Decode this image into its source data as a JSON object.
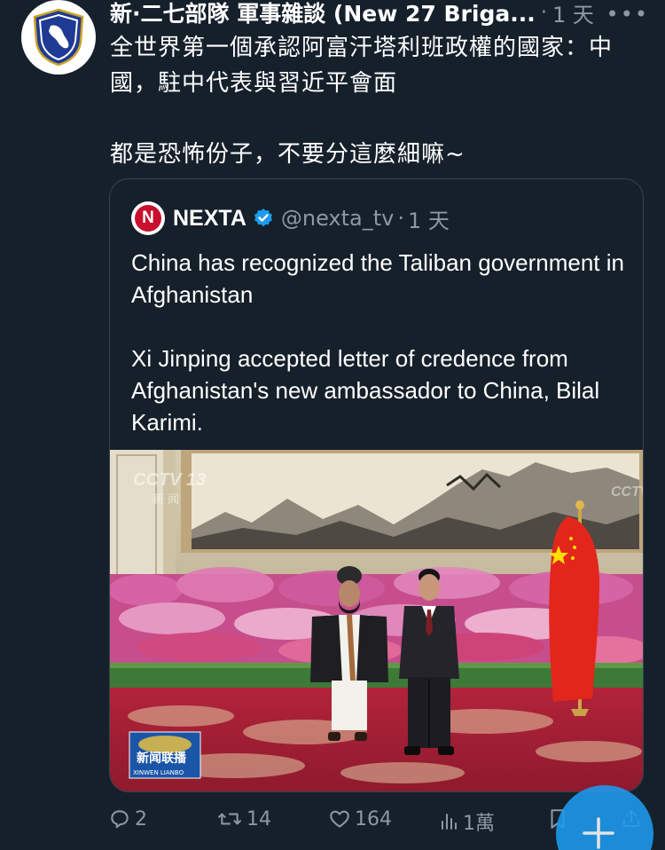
{
  "tweet": {
    "author_name": "新·二七部隊 軍事雜談 (New 27 Briga...",
    "separator": "·",
    "time": "1 天",
    "more_label": "•••",
    "text": "全世界第一個承認阿富汗塔利班政權的國家：中國，駐中代表與習近平會面\n\n都是恐怖份子，不要分這麼細嘛~"
  },
  "quote": {
    "logo_letter": "N",
    "author_name": "NEXTA",
    "handle": "@nexta_tv",
    "separator": "·",
    "time": "1 天",
    "text": "China has recognized the Taliban government in Afghanistan\n\nXi Jinping accepted letter of credence from Afghanistan's new ambassador to China, Bilal Karimi."
  },
  "photo_overlay": {
    "cctv_logo": "CCTV 13",
    "cctv_sub": "新 闻",
    "cctv_right": "CCTV",
    "news_logo": "新闻联播",
    "news_logo_sub": "XINWEN LIANBO"
  },
  "actions": {
    "replies": "2",
    "retweets": "14",
    "likes": "164",
    "views": "1萬"
  },
  "colors": {
    "background": "#15202b",
    "secondary_text": "#8b98a5",
    "border": "#38444d",
    "accent": "#1d9bf0",
    "verified": "#1d9bf0"
  },
  "icons": [
    "shield-emblem-icon",
    "nexta-logo-icon",
    "verified-badge-icon",
    "reply-icon",
    "retweet-icon",
    "like-icon",
    "views-icon",
    "bookmark-icon",
    "share-icon",
    "compose-plus-icon",
    "more-icon"
  ]
}
